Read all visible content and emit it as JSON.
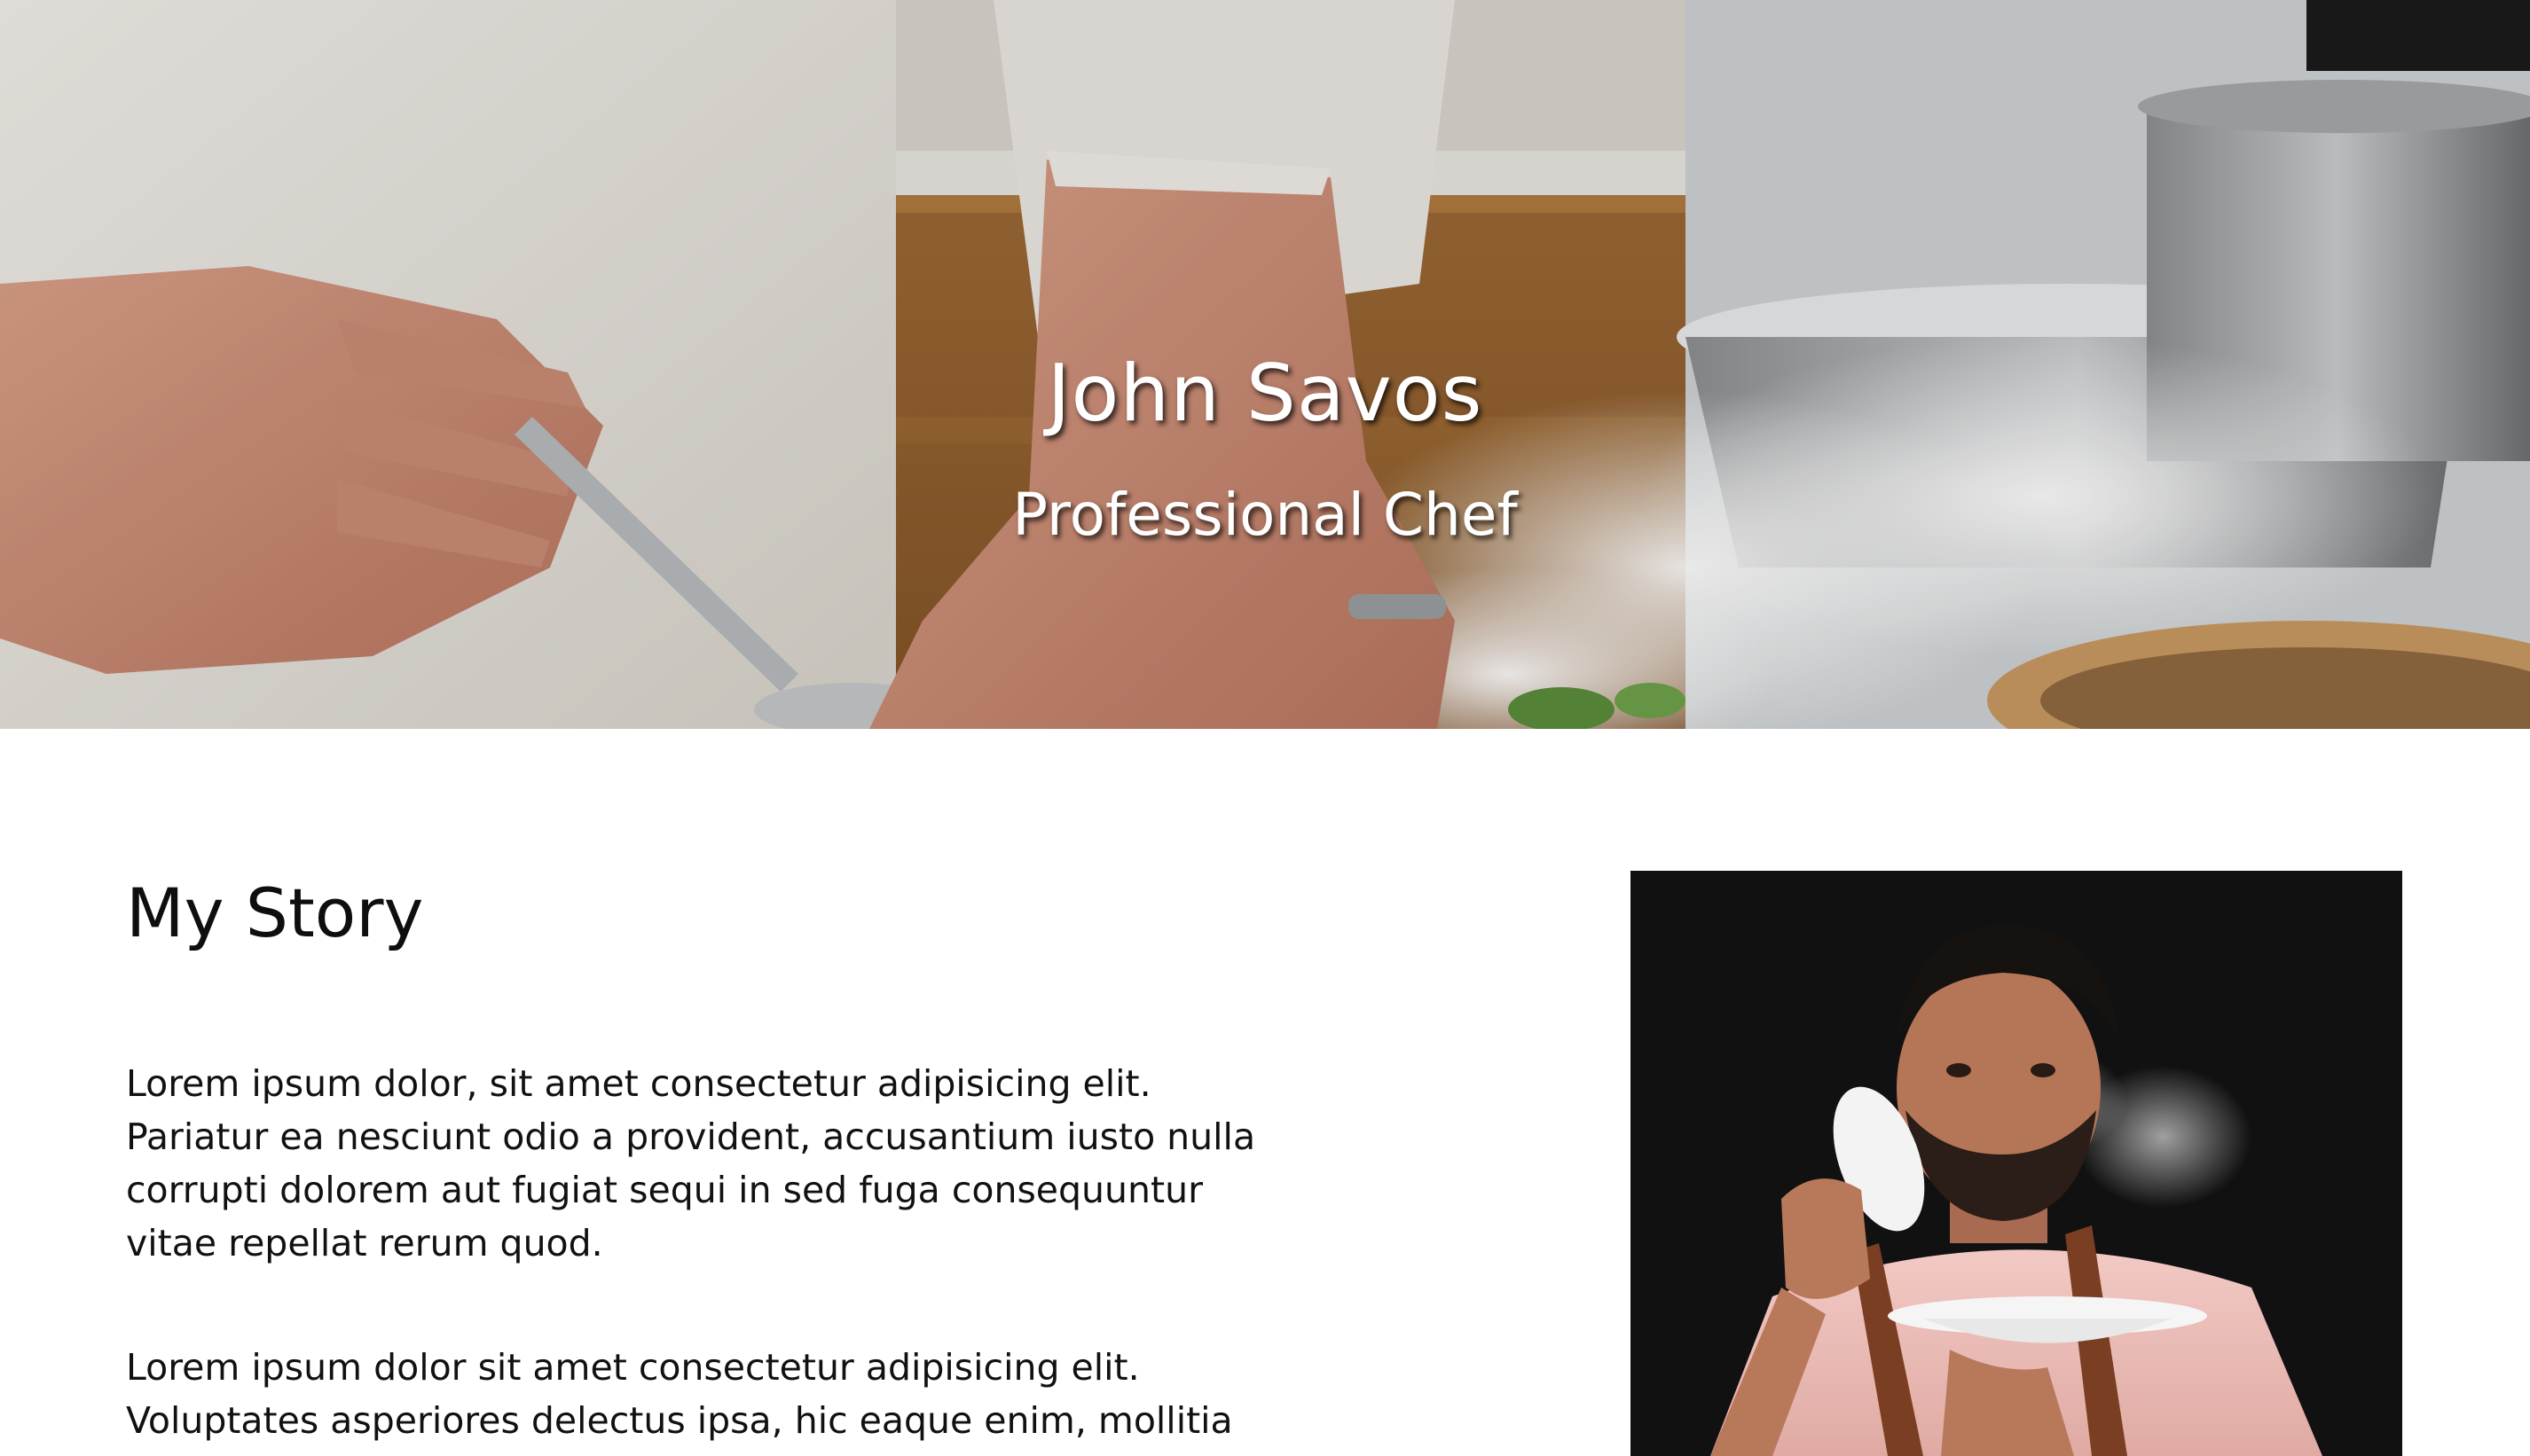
{
  "hero": {
    "title": "John Savos",
    "subtitle": "Professional Chef",
    "image": "chef-plating-dish-photo"
  },
  "story": {
    "heading": "My Story",
    "paragraphs": [
      "Lorem ipsum dolor, sit amet consectetur adipisicing elit. Pariatur ea nesciunt odio a provident, accusantium iusto nulla corrupti dolorem aut fugiat sequi in sed fuga consequuntur vitae repellat rerum quod.",
      "Lorem ipsum dolor sit amet consectetur adipisicing elit. Voluptates asperiores delectus ipsa, hic eaque enim, mollitia nisi"
    ],
    "portrait": "chef-holding-steaming-bowl-photo"
  },
  "colors": {
    "page_background": "#ffffff",
    "heading_text": "#0e0e0e",
    "body_text": "#111111",
    "hero_text": "#ffffff",
    "portrait_background": "#111111"
  }
}
